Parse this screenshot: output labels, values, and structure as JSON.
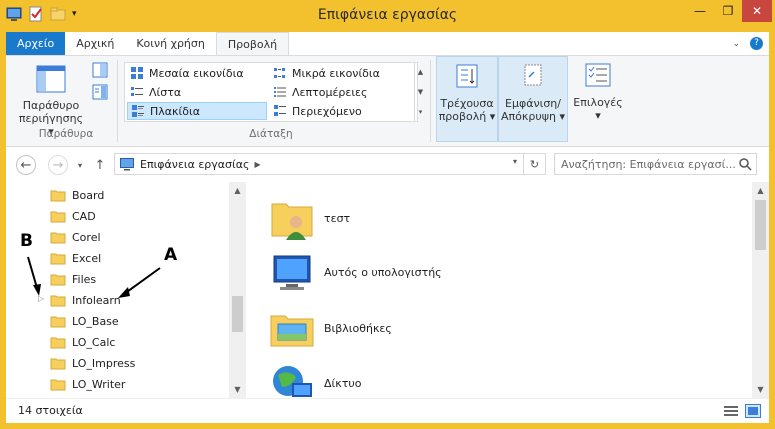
{
  "window": {
    "title": "Επιφάνεια εργασίας"
  },
  "ribbon": {
    "tabs": [
      {
        "label": "Αρχείο"
      },
      {
        "label": "Αρχική"
      },
      {
        "label": "Κοινή χρήση"
      },
      {
        "label": "Προβολή"
      }
    ],
    "panes": {
      "nav_pane_line1": "Παράθυρο",
      "nav_pane_line2": "περιήγησης",
      "group_label": "Παράθυρα"
    },
    "layout": {
      "group_label": "Διάταξη",
      "items": [
        {
          "label": "Μεσαία εικονίδια"
        },
        {
          "label": "Μικρά εικονίδια"
        },
        {
          "label": "Λίστα"
        },
        {
          "label": "Λεπτομέρειες"
        },
        {
          "label": "Πλακίδια"
        },
        {
          "label": "Περιεχόμενο"
        }
      ]
    },
    "current_view": {
      "line1": "Τρέχουσα",
      "line2": "προβολή"
    },
    "show_hide": {
      "line1": "Εμφάνιση/",
      "line2": "Απόκρυψη"
    },
    "options": {
      "label": "Επιλογές"
    }
  },
  "address": {
    "location": "Επιφάνεια εργασίας",
    "search_placeholder": "Αναζήτηση: Επιφάνεια εργασί..."
  },
  "navpane": {
    "folders": [
      {
        "label": "Board"
      },
      {
        "label": "CAD"
      },
      {
        "label": "Corel"
      },
      {
        "label": "Excel"
      },
      {
        "label": "Files"
      },
      {
        "label": "Infolearn"
      },
      {
        "label": "LO_Base"
      },
      {
        "label": "LO_Calc"
      },
      {
        "label": "LO_Impress"
      },
      {
        "label": "LO_Writer"
      }
    ]
  },
  "content": {
    "items": [
      {
        "label": "τεστ"
      },
      {
        "label": "Αυτός ο υπολογιστής"
      },
      {
        "label": "Βιβλιοθήκες"
      },
      {
        "label": "Δίκτυο"
      }
    ]
  },
  "status": {
    "count": "14 στοιχεία"
  },
  "annotations": {
    "a": "A",
    "b": "B"
  },
  "colors": {
    "accent": "#1979ca",
    "titlebar": "#f4c12e",
    "close": "#c7463e",
    "selection": "#cce8ff"
  }
}
